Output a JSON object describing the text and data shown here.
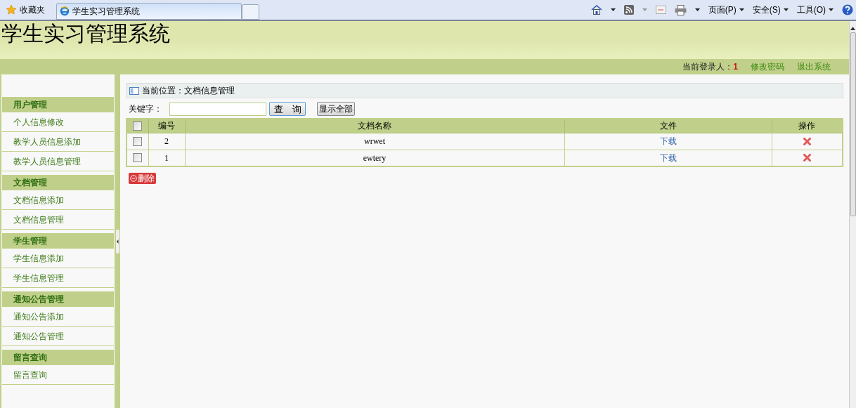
{
  "browser": {
    "favorites": "收藏夹",
    "tab_title": "学生实习管理系统",
    "menus": [
      "页面(P)",
      "安全(S)",
      "工具(O)"
    ]
  },
  "header": {
    "title": "学生实习管理系统",
    "user_label": "当前登录人：",
    "user_value": "1",
    "links": [
      "修改密码",
      "退出系统"
    ]
  },
  "sidebar": {
    "groups": [
      {
        "title": "用户管理",
        "items": [
          "个人信息修改",
          "教学人员信息添加",
          "教学人员信息管理"
        ]
      },
      {
        "title": "文档管理",
        "items": [
          "文档信息添加",
          "文档信息管理"
        ]
      },
      {
        "title": "学生管理",
        "items": [
          "学生信息添加",
          "学生信息管理"
        ]
      },
      {
        "title": "通知公告管理",
        "items": [
          "通知公告添加",
          "通知公告管理"
        ]
      },
      {
        "title": "留言查询",
        "items": [
          "留言查询"
        ]
      }
    ]
  },
  "breadcrumb": "当前位置：文档信息管理",
  "search": {
    "label": "关键字：",
    "query_button": "查　询",
    "show_all_button": "显示全部"
  },
  "table": {
    "select_all_checked": false,
    "columns": [
      "编号",
      "文档名称",
      "文件",
      "操作"
    ],
    "rows": [
      {
        "checked": false,
        "id": "2",
        "name": "wrwet",
        "file": "下载"
      },
      {
        "checked": false,
        "id": "1",
        "name": "ewtery",
        "file": "下载"
      }
    ]
  },
  "delete_button": "删除"
}
